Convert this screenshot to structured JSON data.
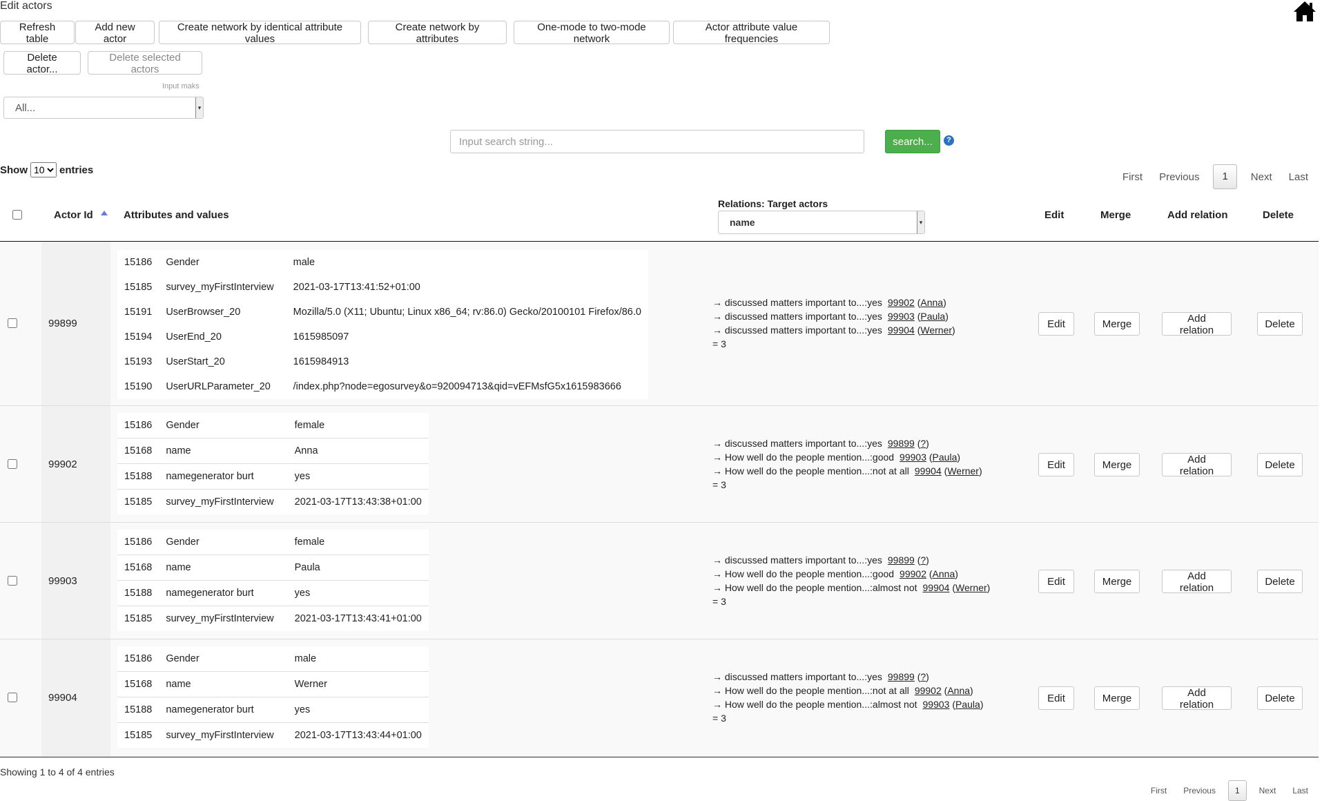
{
  "page": {
    "title": "Edit actors"
  },
  "toolbar": {
    "refresh": "Refresh table",
    "add_actor": "Add new actor",
    "net_identical": "Create network by identical attribute values",
    "net_attributes": "Create network by attributes",
    "one_to_two": "One-mode to two-mode network",
    "attr_freq": "Actor attribute value frequencies",
    "delete_actor": "Delete actor...",
    "delete_selected": "Delete selected actors"
  },
  "input_mask": {
    "label": "Input maks",
    "value": "All..."
  },
  "search": {
    "placeholder": "Input search string...",
    "button": "search...",
    "help": "?"
  },
  "entries": {
    "show": "Show",
    "value": "10",
    "suffix": "entries"
  },
  "pager": {
    "first": "First",
    "previous": "Previous",
    "current": "1",
    "next": "Next",
    "last": "Last"
  },
  "table": {
    "headers": {
      "actor_id": "Actor Id",
      "attributes": "Attributes and values",
      "relations": "Relations: Target actors",
      "relations_select": "name",
      "edit": "Edit",
      "merge": "Merge",
      "add_relation": "Add relation",
      "delete": "Delete"
    },
    "rows": [
      {
        "id": "99899",
        "attributes": [
          [
            "15186",
            "Gender",
            "male"
          ],
          [
            "15185",
            "survey_myFirstInterview",
            "2021-03-17T13:41:52+01:00"
          ],
          [
            "15191",
            "UserBrowser_20",
            "Mozilla/5.0 (X11; Ubuntu; Linux x86_64; rv:86.0) Gecko/20100101 Firefox/86.0"
          ],
          [
            "15194",
            "UserEnd_20",
            "1615985097"
          ],
          [
            "15193",
            "UserStart_20",
            "1615984913"
          ],
          [
            "15190",
            "UserURLParameter_20",
            "/index.php?node=egosurvey&o=920094713&qid=vEFMsfG5x1615983666"
          ]
        ],
        "relations": [
          [
            "→ discussed matters important to...:yes",
            "99902",
            "Anna"
          ],
          [
            "→ discussed matters important to...:yes",
            "99903",
            "Paula"
          ],
          [
            "→ discussed matters important to...:yes",
            "99904",
            "Werner"
          ]
        ],
        "total": "= 3"
      },
      {
        "id": "99902",
        "attributes": [
          [
            "15186",
            "Gender",
            "female"
          ],
          [
            "15168",
            "name",
            "Anna"
          ],
          [
            "15188",
            "namegenerator burt",
            "yes"
          ],
          [
            "15185",
            "survey_myFirstInterview",
            "2021-03-17T13:43:38+01:00"
          ]
        ],
        "relations": [
          [
            "→ discussed matters important to...:yes",
            "99899",
            "?"
          ],
          [
            "→ How well do the people mention...:good",
            "99903",
            "Paula"
          ],
          [
            "→ How well do the people mention...:not at all",
            "99904",
            "Werner"
          ]
        ],
        "total": "= 3"
      },
      {
        "id": "99903",
        "attributes": [
          [
            "15186",
            "Gender",
            "female"
          ],
          [
            "15168",
            "name",
            "Paula"
          ],
          [
            "15188",
            "namegenerator burt",
            "yes"
          ],
          [
            "15185",
            "survey_myFirstInterview",
            "2021-03-17T13:43:41+01:00"
          ]
        ],
        "relations": [
          [
            "→ discussed matters important to...:yes",
            "99899",
            "?"
          ],
          [
            "→ How well do the people mention...:good",
            "99902",
            "Anna"
          ],
          [
            "→ How well do the people mention...:almost not",
            "99904",
            "Werner"
          ]
        ],
        "total": "= 3"
      },
      {
        "id": "99904",
        "attributes": [
          [
            "15186",
            "Gender",
            "male"
          ],
          [
            "15168",
            "name",
            "Werner"
          ],
          [
            "15188",
            "namegenerator burt",
            "yes"
          ],
          [
            "15185",
            "survey_myFirstInterview",
            "2021-03-17T13:43:44+01:00"
          ]
        ],
        "relations": [
          [
            "→ discussed matters important to...:yes",
            "99899",
            "?"
          ],
          [
            "→ How well do the people mention...:not at all",
            "99902",
            "Anna"
          ],
          [
            "→ How well do the people mention...:almost not",
            "99903",
            "Paula"
          ]
        ],
        "total": "= 3"
      }
    ],
    "row_buttons": {
      "edit": "Edit",
      "merge": "Merge",
      "add_relation": "Add relation",
      "delete": "Delete"
    }
  },
  "footer": {
    "info": "Showing 1 to 4 of 4 entries"
  },
  "icons": {
    "home": "home-icon",
    "help": "help-icon",
    "sort": "sort-ascending-icon"
  },
  "colors": {
    "search_button": "#4cae4c",
    "help_icon": "#2a73c2",
    "sort_icon": "#6a7bd6"
  }
}
